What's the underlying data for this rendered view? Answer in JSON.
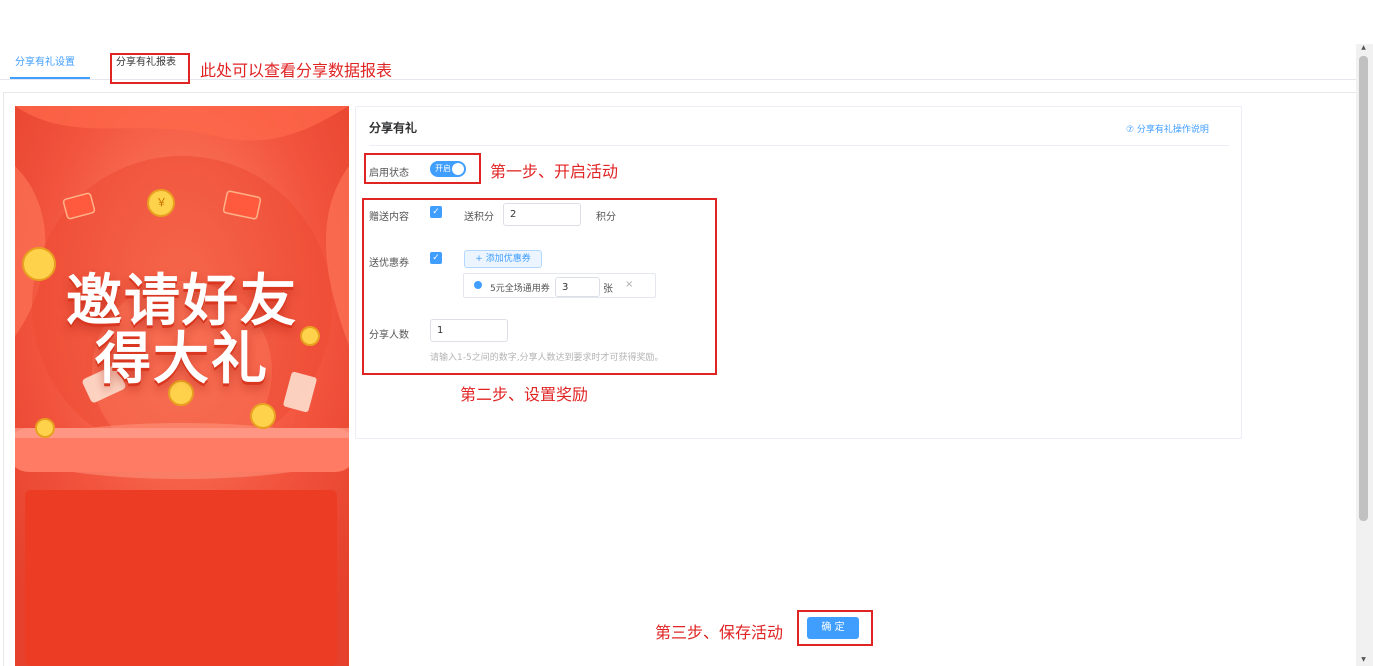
{
  "tabs": {
    "settings_label": "分享有礼设置",
    "report_label": "分享有礼报表"
  },
  "annotations": {
    "report_hint": "此处可以查看分享数据报表",
    "step1": "第一步、开启活动",
    "step2": "第二步、设置奖励",
    "step3": "第三步、保存活动"
  },
  "poster": {
    "line1": "邀请好友",
    "line2": "得大礼",
    "coin_symbol": "￥"
  },
  "card": {
    "title": "分享有礼",
    "help_label": "⑦ 分享有礼操作说明"
  },
  "form": {
    "status_label": "启用状态",
    "switch_text": "开启",
    "switch_on": true,
    "gift_label": "赠送内容",
    "points_label": "送积分",
    "points_value": "2",
    "points_unit": "积分",
    "coupon_label": "送优惠券",
    "add_coupon_label": "+ 添加优惠券",
    "coupon_name": "5元全场通用券",
    "coupon_qty": "3",
    "coupon_unit": "张",
    "coupon_remove": "×",
    "share_count_label": "分享人数",
    "share_count_value": "1",
    "share_hint": "请输入1-5之间的数字,分享人数达到要求时才可获得奖励。"
  },
  "actions": {
    "confirm_label": "确 定"
  },
  "colors": {
    "accent": "#409eff",
    "annotation": "#e02424",
    "poster_red": "#f4543f"
  }
}
